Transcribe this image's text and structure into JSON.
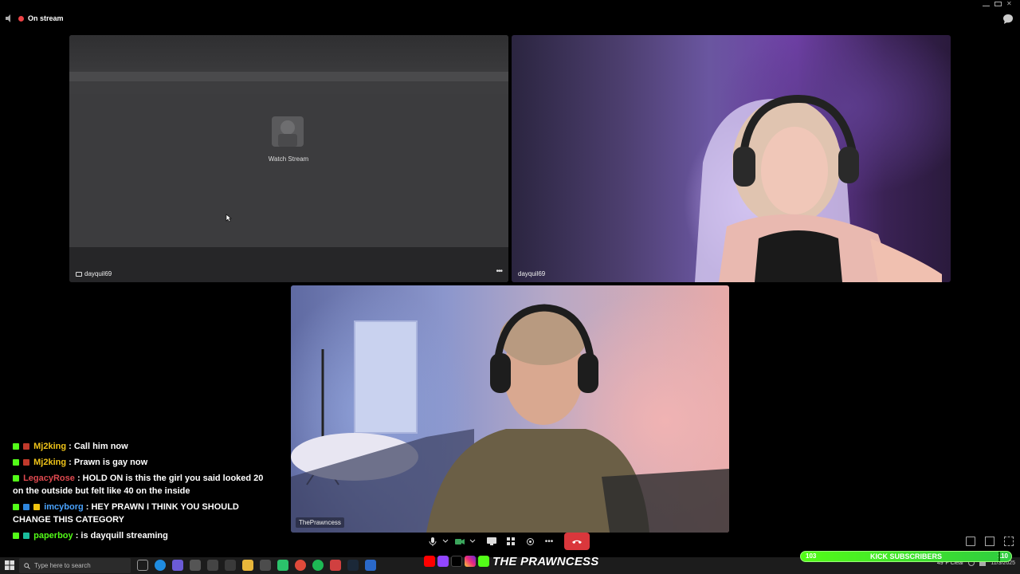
{
  "topbar": {
    "status": "On stream"
  },
  "tiles": {
    "stream": {
      "watch_label": "Watch Stream",
      "user": "dayquil69"
    },
    "camera_girl": {
      "user": "dayquil69"
    },
    "camera_main": {
      "user": "ThePrawncess"
    }
  },
  "chat": {
    "messages": [
      {
        "user": "Mj2king",
        "user_color": "#f0c419",
        "text": ": Call him now"
      },
      {
        "user": "Mj2king",
        "user_color": "#f0c419",
        "text": ": Prawn is gay now"
      },
      {
        "user": "LegacyRose",
        "user_color": "#e0494f",
        "text": ": HOLD ON is this the girl you said looked 20 on the outside but felt like 40 on the inside"
      },
      {
        "user": "imcyborg",
        "user_color": "#4aa3ff",
        "text": ": HEY PRAWN I THINK YOU SHOULD CHANGE THIS CATEGORY"
      },
      {
        "user": "paperboy",
        "user_color": "#53fc18",
        "text": ": is dayquill streaming"
      }
    ]
  },
  "brand": {
    "name": "THE PRAWNCESS"
  },
  "taskbar": {
    "search_placeholder": "Type here to search",
    "weather": "49°F Clear",
    "date": "11/3/2025"
  },
  "subgoal": {
    "label": "KICK SUBSCRIBERS",
    "current": "103",
    "goal": "110",
    "progress_fraction": 0.94
  },
  "colors": {
    "accent": "#53fc18",
    "hangup": "#da373c",
    "live_dot": "#ed4245"
  }
}
